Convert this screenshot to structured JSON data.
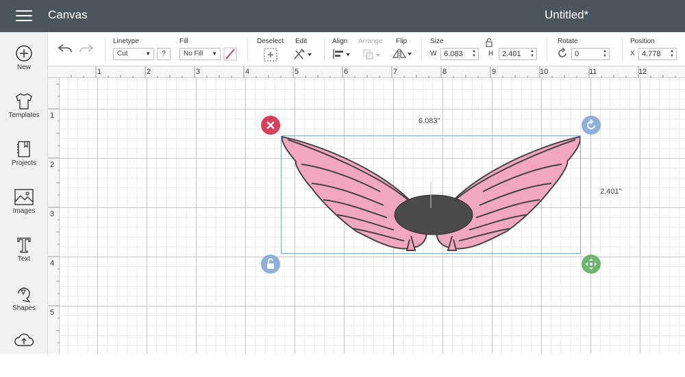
{
  "header": {
    "app_title": "Canvas",
    "doc_title": "Untitled*"
  },
  "sidebar": {
    "items": [
      {
        "label": "New",
        "icon": "plus-circle-icon"
      },
      {
        "label": "Templates",
        "icon": "tshirt-icon"
      },
      {
        "label": "Projects",
        "icon": "notebook-icon"
      },
      {
        "label": "Images",
        "icon": "image-icon"
      },
      {
        "label": "Text",
        "icon": "text-T-icon"
      },
      {
        "label": "Shapes",
        "icon": "shapes-icon"
      },
      {
        "label": "",
        "icon": "upload-cloud-icon"
      }
    ]
  },
  "toolbar": {
    "linetype": {
      "label": "Linetype",
      "value": "Cut",
      "help": "?"
    },
    "fill": {
      "label": "Fill",
      "value": "No Fill"
    },
    "deselect": {
      "label": "Deselect"
    },
    "edit": {
      "label": "Edit"
    },
    "align": {
      "label": "Align"
    },
    "arrange": {
      "label": "Arrange"
    },
    "flip": {
      "label": "Flip"
    },
    "size": {
      "label": "Size",
      "w_label": "W",
      "w_value": "6.083",
      "h_label": "H",
      "h_value": "2.401"
    },
    "rotate": {
      "label": "Rotate",
      "value": "0"
    },
    "position": {
      "label": "Position",
      "x_label": "X",
      "x_value": "4.778"
    }
  },
  "ruler": {
    "top": [
      "1",
      "2",
      "3",
      "4",
      "5",
      "6",
      "7",
      "8",
      "9",
      "10",
      "11",
      "12"
    ],
    "left": [
      "1",
      "2",
      "3",
      "4",
      "5"
    ]
  },
  "selection": {
    "width_label": "6.083\"",
    "height_label": "2.401\""
  },
  "colors": {
    "header_bg": "#4a565c",
    "wing_fill": "#f2a7c0",
    "wing_stroke": "#444444",
    "ellipse_fill": "#4a4a4a",
    "delete_handle": "#d9415a",
    "rotate_handle": "#8fb0d8",
    "lock_handle": "#8fb0d8",
    "move_handle": "#6fb56f"
  }
}
